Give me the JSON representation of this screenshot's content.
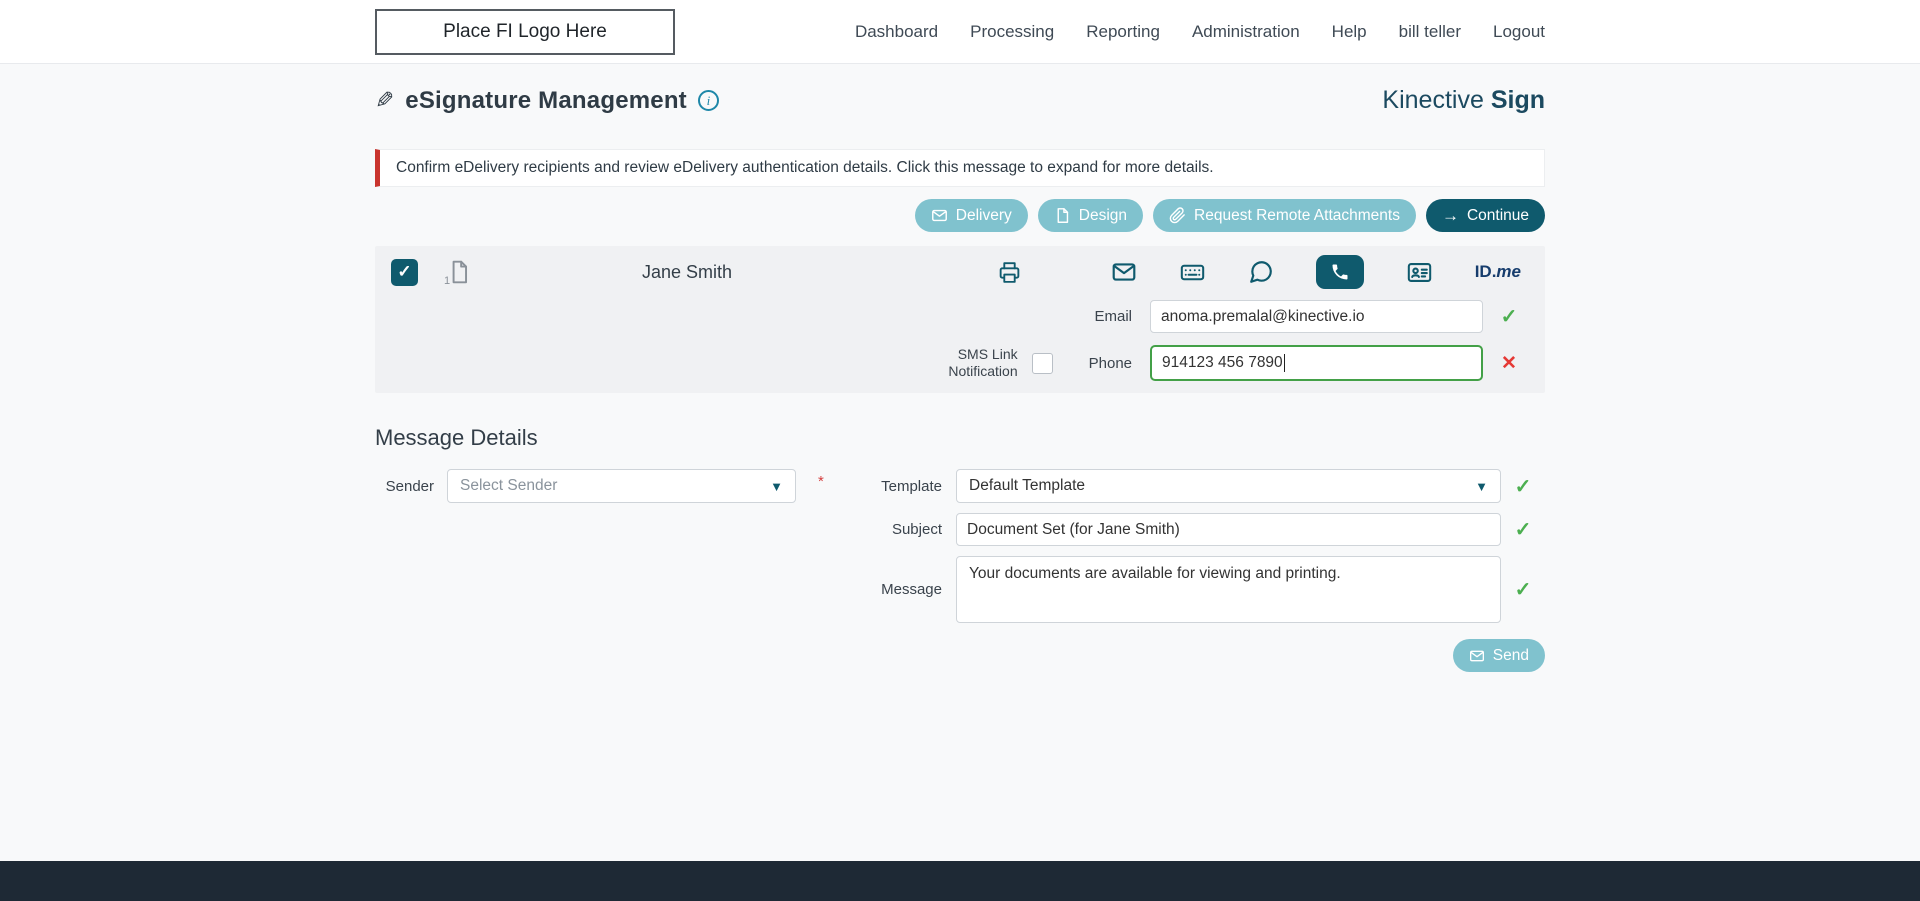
{
  "nav": {
    "logo_placeholder": "Place FI Logo Here",
    "items": [
      {
        "label": "Dashboard"
      },
      {
        "label": "Processing"
      },
      {
        "label": "Reporting"
      },
      {
        "label": "Administration"
      },
      {
        "label": "Help"
      },
      {
        "label": "bill teller"
      },
      {
        "label": "Logout"
      }
    ]
  },
  "header": {
    "title": "eSignature Management",
    "brand_first": "Kinective",
    "brand_second": "Sign"
  },
  "alert": {
    "text": "Confirm eDelivery recipients and review eDelivery authentication details. Click this message to expand for more details."
  },
  "toolbar": {
    "delivery": "Delivery",
    "design": "Design",
    "request_remote_attachments": "Request Remote Attachments",
    "continue": "Continue"
  },
  "recipient": {
    "name": "Jane Smith",
    "document_count": "1",
    "email_label": "Email",
    "email_value": "anoma.premalal@kinective.io",
    "sms_line1": "SMS Link",
    "sms_line2": "Notification",
    "phone_label": "Phone",
    "phone_value": "914123 456 7890",
    "idme_primary": "ID.",
    "idme_secondary": "me"
  },
  "message_details": {
    "heading": "Message Details",
    "sender_label": "Sender",
    "sender_value": "Select Sender",
    "required_marker": "*",
    "template_label": "Template",
    "template_value": "Default Template",
    "subject_label": "Subject",
    "subject_value": "Document Set (for Jane Smith)",
    "message_label": "Message",
    "message_value": "Your documents are available for viewing and printing.",
    "send": "Send"
  },
  "icons": {
    "pen": "✎",
    "info": "i",
    "check": "✓",
    "x": "✕",
    "caret": "▼",
    "arrow_right": "→"
  },
  "colors": {
    "accent_dark": "#0f5a6d",
    "accent_light": "#80c2ce",
    "success": "#4caf50",
    "error": "#e53935",
    "alert_border": "#c9342e",
    "brand_text": "#1c4a60",
    "footer": "#1e2935"
  }
}
